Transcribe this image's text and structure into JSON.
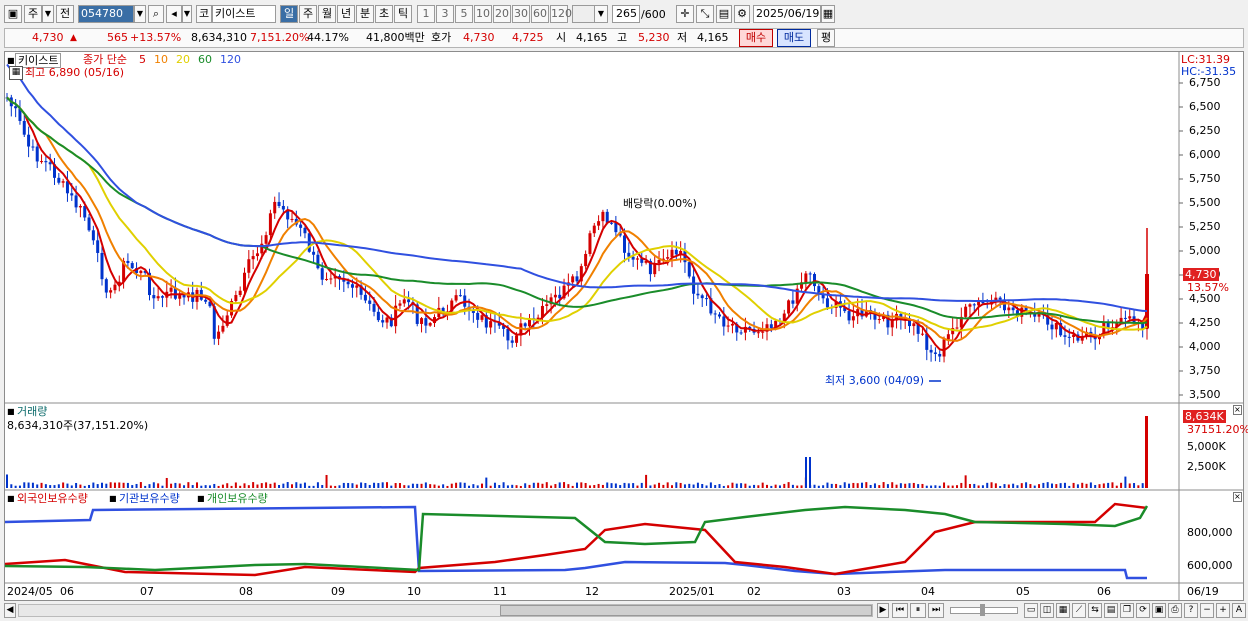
{
  "toolbar": {
    "period_label": "주",
    "prev_label": "전",
    "code": "054780",
    "market_label": "코",
    "stock_name": "키이스트",
    "period_tabs": [
      "일",
      "주",
      "월",
      "년",
      "분",
      "초",
      "틱"
    ],
    "interval_tabs": [
      "1",
      "3",
      "5",
      "10",
      "20",
      "30",
      "60",
      "120"
    ],
    "count_value": "265",
    "count_total": "/600",
    "date": "2025/06/19"
  },
  "quote": {
    "price": "4,730",
    "change": "565",
    "change_pct": "+13.57%",
    "volume": "8,634,310",
    "volume_pct": "7,151.20%",
    "turnover": "44.17%",
    "amount": "41,800백만",
    "hoga_label": "호가",
    "ask": "4,730",
    "bid": "4,725",
    "open_label": "시",
    "open": "4,165",
    "high_label": "고",
    "high": "5,230",
    "low_label": "저",
    "low": "4,165",
    "buy_label": "매수",
    "sell_label": "매도",
    "eval_label": "평"
  },
  "legend": {
    "name": "키이스트",
    "ma_title": "종가 단순",
    "ma_periods": [
      "5",
      "10",
      "20",
      "60",
      "120"
    ],
    "ma_colors": [
      "#d40000",
      "#f08000",
      "#e0d000",
      "#1a8c2a",
      "#3050e0"
    ],
    "high_note": "최고 6,890 (05/16)",
    "low_note": "최저 3,600 (04/09)",
    "dividend_note": "배당락(0.00%)",
    "lc": "LC:31.39",
    "hc": "HC:-31.35",
    "price_tag": "4,730",
    "pct_tag": "13.57%"
  },
  "price_axis": [
    "6,750",
    "6,500",
    "6,250",
    "6,000",
    "5,750",
    "5,500",
    "5,250",
    "5,000",
    "4,750",
    "4,500",
    "4,250",
    "4,000",
    "3,750",
    "3,500"
  ],
  "volume_panel": {
    "title": "거래량",
    "value": "8,634,310주(37,151.20%)",
    "tag": "8,634K",
    "tag_pct": "37151.20%",
    "axis": [
      "5,000K",
      "2,500K"
    ]
  },
  "holdings_panel": {
    "foreign": "외국인보유수량",
    "inst": "기관보유수량",
    "indiv": "개인보유수량",
    "axis": [
      "800,000",
      "600,000"
    ]
  },
  "x_axis": [
    "2024/05",
    "06",
    "07",
    "08",
    "09",
    "10",
    "11",
    "12",
    "2025/01",
    "02",
    "03",
    "04",
    "05",
    "06",
    "06/19"
  ],
  "colors": {
    "up": "#d40000",
    "down": "#0033cc",
    "tag_bg": "#e02020"
  }
}
